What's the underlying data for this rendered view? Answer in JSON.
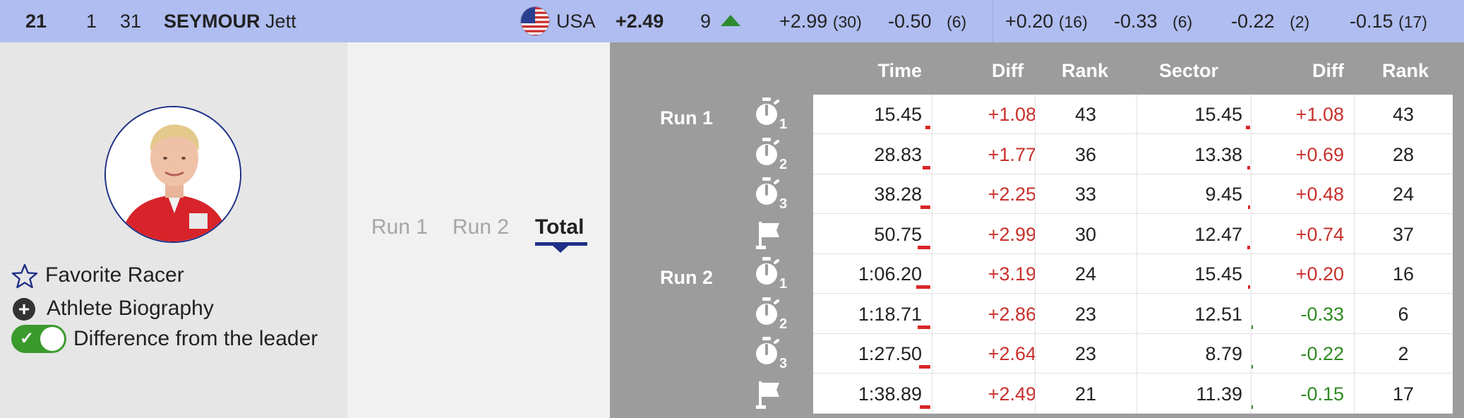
{
  "header": {
    "rank": "21",
    "bib": "1",
    "number": "31",
    "last_name": "SEYMOUR",
    "first_name": "Jett",
    "country": "USA",
    "total_diff": "+2.49",
    "position": "9",
    "position_trend": "up",
    "s1_diff": "+2.99",
    "s1_rank": "(30)",
    "s2_diff": "-0.50",
    "s2_rank": "(6)",
    "s3_diff": "+0.20",
    "s3_rank": "(16)",
    "s4_diff": "-0.33",
    "s4_rank": "(6)",
    "s5_diff": "-0.22",
    "s5_rank": "(2)",
    "s6_diff": "-0.15",
    "s6_rank": "(17)"
  },
  "left": {
    "favorite_label": "Favorite Racer",
    "biography_label": "Athlete Biography",
    "difference_label": "Difference from the leader",
    "difference_toggle_on": true
  },
  "tabs": [
    {
      "label": "Run 1",
      "active": false
    },
    {
      "label": "Run 2",
      "active": false
    },
    {
      "label": "Total",
      "active": true
    }
  ],
  "columns": {
    "time": "Time",
    "diff": "Diff",
    "rank": "Rank",
    "sector": "Sector",
    "sector_diff": "Diff",
    "sector_rank": "Rank"
  },
  "runs": [
    {
      "label": "Run 1"
    },
    {
      "label": "Run 2"
    }
  ],
  "rows": [
    {
      "icon": "stopwatch-icon",
      "sub": "1",
      "time": "15.45",
      "diff": "+1.08",
      "rank": "43",
      "sector": "15.45",
      "sdiff": "+1.08",
      "srank": "43",
      "time_bar": 0.1,
      "sector_bar": 0.1,
      "sector_sign": "plus"
    },
    {
      "icon": "stopwatch-icon",
      "sub": "2",
      "time": "28.83",
      "diff": "+1.77",
      "rank": "36",
      "sector": "13.38",
      "sdiff": "+0.69",
      "srank": "28",
      "time_bar": 0.16,
      "sector_bar": 0.06,
      "sector_sign": "plus"
    },
    {
      "icon": "stopwatch-icon",
      "sub": "3",
      "time": "38.28",
      "diff": "+2.25",
      "rank": "33",
      "sector": "9.45",
      "sdiff": "+0.48",
      "srank": "24",
      "time_bar": 0.2,
      "sector_bar": 0.04,
      "sector_sign": "plus"
    },
    {
      "icon": "finish-flag-icon",
      "sub": "",
      "time": "50.75",
      "diff": "+2.99",
      "rank": "30",
      "sector": "12.47",
      "sdiff": "+0.74",
      "srank": "37",
      "time_bar": 0.26,
      "sector_bar": 0.06,
      "sector_sign": "plus"
    },
    {
      "icon": "stopwatch-icon",
      "sub": "1",
      "time": "1:06.20",
      "diff": "+3.19",
      "rank": "24",
      "sector": "15.45",
      "sdiff": "+0.20",
      "srank": "16",
      "time_bar": 0.28,
      "sector_bar": 0.02,
      "sector_sign": "plus"
    },
    {
      "icon": "stopwatch-icon",
      "sub": "2",
      "time": "1:18.71",
      "diff": "+2.86",
      "rank": "23",
      "sector": "12.51",
      "sdiff": "-0.33",
      "srank": "6",
      "time_bar": 0.25,
      "sector_bar": 0.02,
      "sector_sign": "minus"
    },
    {
      "icon": "stopwatch-icon",
      "sub": "3",
      "time": "1:27.50",
      "diff": "+2.64",
      "rank": "23",
      "sector": "8.79",
      "sdiff": "-0.22",
      "srank": "2",
      "time_bar": 0.23,
      "sector_bar": 0.02,
      "sector_sign": "minus"
    },
    {
      "icon": "finish-flag-icon",
      "sub": "",
      "time": "1:38.89",
      "diff": "+2.49",
      "rank": "21",
      "sector": "11.39",
      "sdiff": "-0.15",
      "srank": "17",
      "time_bar": 0.22,
      "sector_bar": 0.01,
      "sector_sign": "minus"
    }
  ],
  "colors": {
    "header_bg": "#b0bdf0",
    "accent_navy": "#1e2f86",
    "diff_red": "#c8302c",
    "diff_green": "#2e8a22",
    "toggle_green": "#3a9a2c",
    "panel_gray": "#9c9c9c"
  }
}
